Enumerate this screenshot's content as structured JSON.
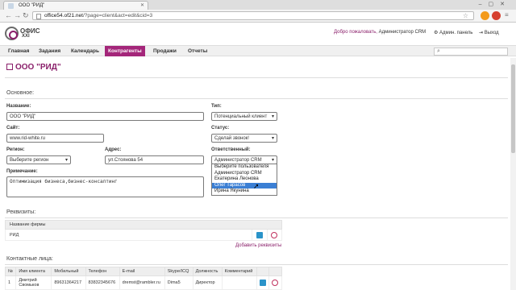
{
  "browser": {
    "tab_title": "ООО \"РИД\"",
    "url_domain": "office54.of21.net",
    "url_path": "/?page=client&act=edit&cid=3"
  },
  "header": {
    "logo_line1": "ОФИС",
    "logo_line2": "XXI",
    "welcome": "Добро пожаловать,",
    "user": "Администратор CRM",
    "admin_panel": "Админ. панель",
    "logout": "Выход"
  },
  "menu": {
    "items": [
      "Главная",
      "Задания",
      "Календарь",
      "Контрагенты",
      "Продажи",
      "Отчеты"
    ],
    "active": "Контрагенты"
  },
  "page": {
    "title": "ООО \"РИД\"",
    "section_main": "Основное:",
    "section_requisites": "Реквизиты:",
    "section_contacts": "Контактные лица:"
  },
  "form": {
    "name_label": "Название:",
    "name_value": "ООО \"РИД\"",
    "type_label": "Тип:",
    "type_value": "Потенциальный клиент",
    "site_label": "Сайт:",
    "site_value": "www.rid-white.ru",
    "status_label": "Статус:",
    "status_value": "Сделай звонок!",
    "region_label": "Регион:",
    "region_value": "Выберите регион",
    "address_label": "Адрес:",
    "address_value": "ул.Стоянова 54",
    "responsible_label": "Ответственный:",
    "responsible_value": "Администратор CRM",
    "note_label": "Примечание:",
    "note_value": "Оптимизация бизнеса,бизнес-консалтинг"
  },
  "dropdown": {
    "options": [
      "Выберите пользователя",
      "Администратор CRM",
      "Екатерина Леонова",
      "Олег Тарасов",
      "Ирина Якунина"
    ],
    "highlighted": "Олег Тарасов"
  },
  "requisites": {
    "header": "Название фирмы",
    "row": "РИД",
    "add_link": "Добавить реквизиты"
  },
  "contacts": {
    "headers": [
      "№",
      "Имя клиента",
      "Мобильный",
      "Телефон",
      "E-mail",
      "Skype/ICQ",
      "Должность",
      "Комментарий"
    ],
    "rows": [
      [
        "1",
        "Дмитрий Свомьков",
        "89631364217",
        "83832345676",
        "dremst@rambler.ru",
        "Dima5",
        "Директор",
        ""
      ]
    ]
  }
}
